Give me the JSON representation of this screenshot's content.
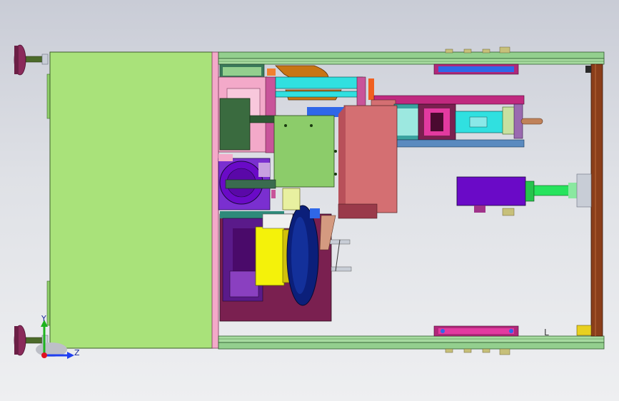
{
  "viewport": {
    "background_top": "#c9ccd6",
    "background_bottom": "#eeeff1"
  },
  "triad": {
    "y_label": "Y",
    "z_label": "Z",
    "y_color": "#1eb31e",
    "z_color": "#1f3ff0",
    "x_color": "#e01020"
  },
  "colors": {
    "panel_green": "#a9e27a",
    "rail_green": "#93cf8e",
    "pink": "#f3a9c9",
    "magenta": "#c0297f",
    "purple": "#6a0ac7",
    "yellow": "#f4f20a",
    "navy": "#0b1f7a",
    "brown": "#8a3e1a",
    "salmon": "#d46f72",
    "cyan": "#30e0e0",
    "blue": "#2f67e8",
    "orange": "#c87514",
    "dark_green": "#3a6b3f",
    "bright_green": "#27e35d"
  }
}
